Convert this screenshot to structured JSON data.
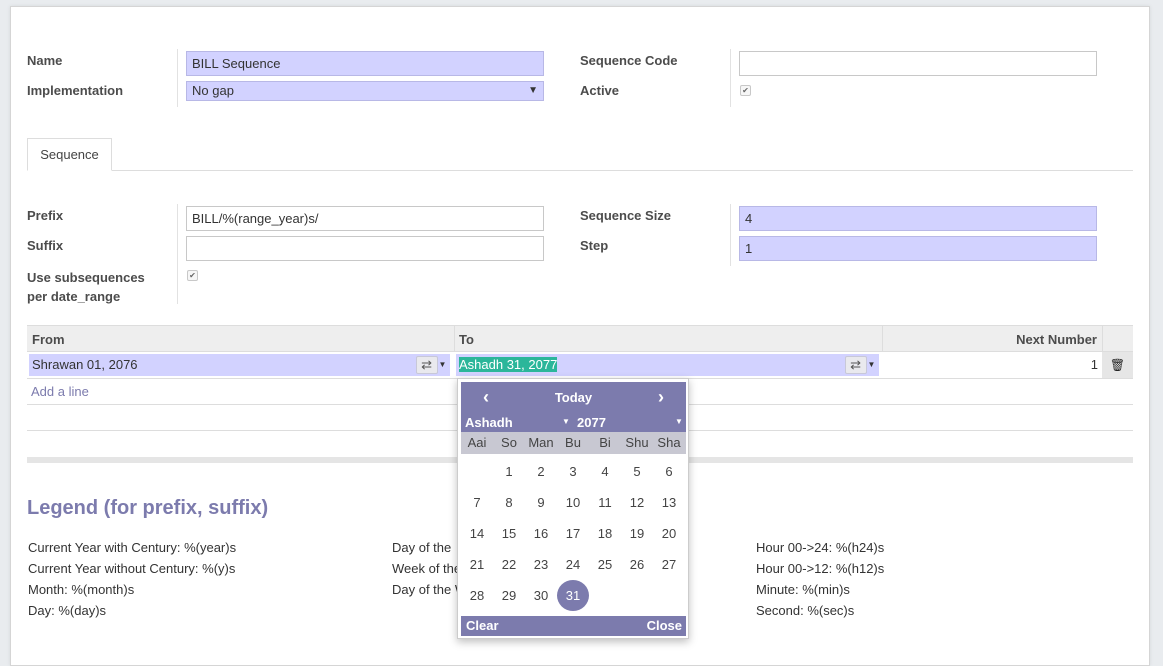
{
  "form": {
    "name_label": "Name",
    "name_value": "BILL Sequence",
    "implementation_label": "Implementation",
    "implementation_value": "No gap",
    "sequence_code_label": "Sequence Code",
    "sequence_code_value": "",
    "active_label": "Active",
    "active_checked": true
  },
  "tabs": [
    {
      "label": "Sequence"
    }
  ],
  "sequence": {
    "prefix_label": "Prefix",
    "prefix_value": "BILL/%(range_year)s/",
    "suffix_label": "Suffix",
    "suffix_value": "",
    "subseq_label_1": "Use subsequences",
    "subseq_label_2": "per date_range",
    "subseq_checked": true,
    "size_label": "Sequence Size",
    "size_value": "4",
    "step_label": "Step",
    "step_value": "1"
  },
  "date_ranges": {
    "headers": {
      "from": "From",
      "to": "To",
      "next": "Next Number"
    },
    "rows": [
      {
        "from": "Shrawan 01, 2076",
        "to": "Ashadh 31, 2077",
        "next": "1"
      }
    ],
    "add_line": "Add a line"
  },
  "datepicker": {
    "today_label": "Today",
    "month": "Ashadh",
    "year": "2077",
    "weekdays": [
      "Aai",
      "So",
      "Man",
      "Bu",
      "Bi",
      "Shu",
      "Sha"
    ],
    "selected_day": "31",
    "weeks": [
      [
        "",
        "1",
        "2",
        "3",
        "4",
        "5",
        "6"
      ],
      [
        "7",
        "8",
        "9",
        "10",
        "11",
        "12",
        "13"
      ],
      [
        "14",
        "15",
        "16",
        "17",
        "18",
        "19",
        "20"
      ],
      [
        "21",
        "22",
        "23",
        "24",
        "25",
        "26",
        "27"
      ],
      [
        "28",
        "29",
        "30",
        "31",
        "",
        "",
        ""
      ]
    ],
    "clear_label": "Clear",
    "close_label": "Close"
  },
  "legend": {
    "title": "Legend (for prefix, suffix)",
    "col1": [
      "Current Year with Century: %(year)s",
      "Current Year without Century: %(y)s",
      "Month: %(month)s",
      "Day: %(day)s"
    ],
    "col2": [
      "Day of the ",
      "Week of the",
      "Day of the W"
    ],
    "col3": [
      "Hour 00->24: %(h24)s",
      "Hour 00->12: %(h12)s",
      "Minute: %(min)s",
      "Second: %(sec)s"
    ]
  },
  "colors": {
    "accent": "#7c7bad",
    "required_bg": "#d2d2ff",
    "selection": "#2bb69a"
  }
}
